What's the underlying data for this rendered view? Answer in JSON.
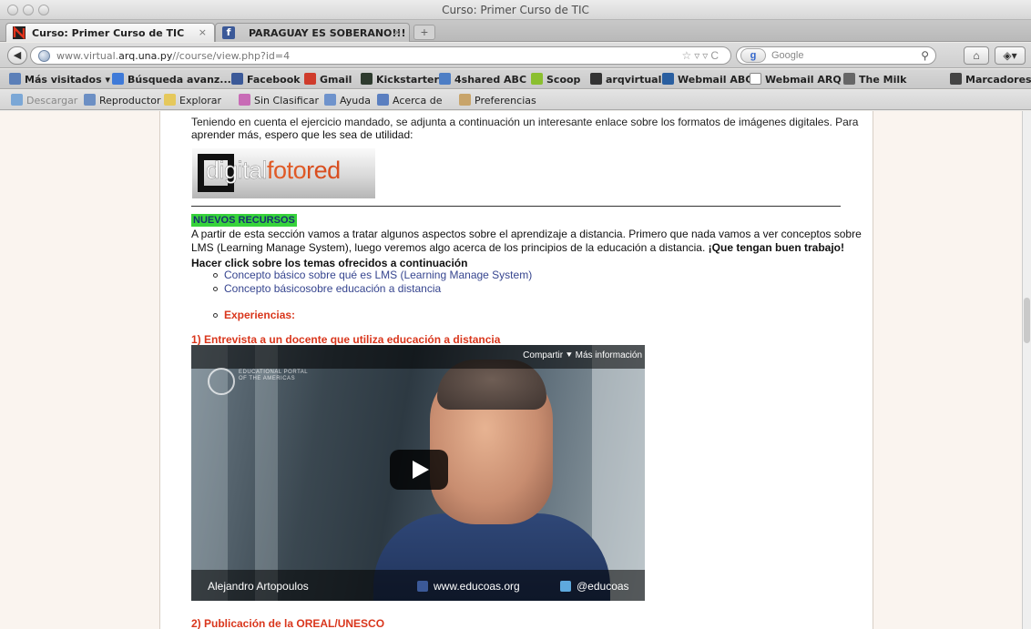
{
  "window": {
    "title": "Curso: Primer Curso de TIC"
  },
  "tabs": [
    {
      "label": "Curso: Primer Curso de TIC",
      "close": "×"
    },
    {
      "label": "PARAGUAY ES SOBERANO!!!",
      "close": "×"
    }
  ],
  "new_tab": "+",
  "nav": {
    "url_prefix": "www.virtual.",
    "url_domain": "arq.una.py",
    "url_suffix": "//course/view.php?id=4",
    "search_engine": "Google",
    "search_badge": "g"
  },
  "bookmarks": [
    {
      "label": "Más visitados ▾",
      "icon": "bookmarks-folder-icon",
      "color": "#5b7fb8"
    },
    {
      "label": "Búsqueda avanz...",
      "icon": "google-icon",
      "color": "#3f7ad8"
    },
    {
      "label": "Facebook",
      "icon": "facebook-icon",
      "color": "#3b5998"
    },
    {
      "label": "Gmail",
      "icon": "gmail-icon",
      "color": "#cf3b2b"
    },
    {
      "label": "Kickstarter",
      "icon": "kickstarter-icon",
      "color": "#2e3b2e"
    },
    {
      "label": "4shared ABC",
      "icon": "4shared-icon",
      "color": "#4d7ec5"
    },
    {
      "label": "Scoop",
      "icon": "scoop-icon",
      "color": "#8bbf2f"
    },
    {
      "label": "arqvirtual",
      "icon": "arqvirtual-icon",
      "color": "#333333"
    },
    {
      "label": "Webmail ABC",
      "icon": "webmail-abc-icon",
      "color": "#2a5fa0"
    },
    {
      "label": "Webmail ARQ",
      "icon": "webmail-arq-icon",
      "color": "#ffffff"
    },
    {
      "label": "The Milk",
      "icon": "calendar-icon",
      "color": "#666666"
    },
    {
      "label": "Marcadores ▾",
      "icon": "bookmarks-menu-icon",
      "color": "#444444"
    }
  ],
  "toolbar": [
    {
      "label": "Descargar",
      "icon": "download-icon",
      "disabled": true
    },
    {
      "label": "Reproductor",
      "icon": "player-icon",
      "disabled": false
    },
    {
      "label": "Explorar",
      "icon": "explore-icon",
      "disabled": false
    },
    {
      "label": "Sin Clasificar",
      "icon": "unclassified-icon",
      "disabled": false
    },
    {
      "label": "Ayuda",
      "icon": "help-icon",
      "disabled": false
    },
    {
      "label": "Acerca de",
      "icon": "about-icon",
      "disabled": false
    },
    {
      "label": "Preferencias",
      "icon": "preferences-icon",
      "disabled": false
    }
  ],
  "page": {
    "cut_line": "Teniendo en cuenta el ejercicio mandado, se adjunta a continuación un interesante enlace sobre los formatos de imágenes digitales. Para",
    "intro_line2": "aprender más, espero que les sea de utilidad:",
    "logo": {
      "part1": "digital",
      "part2": "foto",
      "part3": "red"
    },
    "section_badge": "NUEVOS RECURSOS",
    "para1_line1": "A partir de esta sección vamos a tratar algunos aspectos sobre el aprendizaje a distancia. Primero que nada vamos a ver conceptos sobre",
    "para1_line2_a": "LMS (Learning Manage System), luego veremos algo acerca de los principios de la educación a distancia. ",
    "para1_line2_b": "¡Que tengan buen trabajo!",
    "topics_heading": "Hacer click sobre los temas ofrecidos a continuación",
    "links": [
      "Concepto básico sobre qué es LMS (Learning Manage System)",
      "Concepto básicosobre educación a distancia"
    ],
    "experiences": "Experiencias:",
    "item1": "1) Entrevista a un docente que utiliza educación a distancia",
    "item2": "2) Publicación de la OREAL/UNESCO"
  },
  "video": {
    "share": "Compartir",
    "more_info": "Más información",
    "logo_text_1": "EDUCATIONAL PORTAL",
    "logo_text_2": "OF THE AMERICAS",
    "speaker": "Alejandro Artopoulos",
    "site": "www.educoas.org",
    "twitter": "@educoas"
  }
}
